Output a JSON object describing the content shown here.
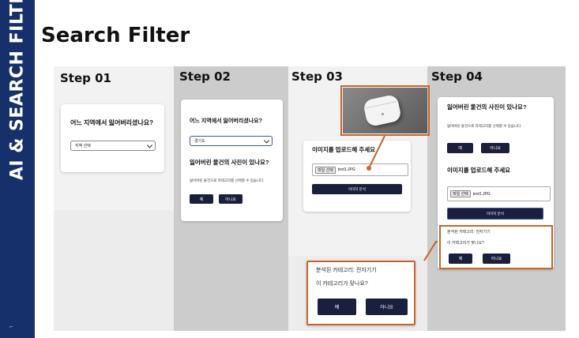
{
  "sidebar": {
    "title": "AI & SEARCH FILTER"
  },
  "slide": {
    "title": "Search Filter"
  },
  "steps": [
    {
      "label": "Step 01",
      "question": "어느 지역에서 잃어버리셨나요?",
      "select_value": "지역 선택"
    },
    {
      "label": "Step 02",
      "question": "어느 지역에서 잃어버리셨나요?",
      "select_value": "경기도",
      "photo_question": "잃어버린 물건의 사진이 있나요?",
      "photo_hint": "잃어버린 물건으로 카테고리를 선택할 수 있습니다.",
      "yes": "예",
      "no": "아니요"
    },
    {
      "label": "Step 03",
      "upload_title": "이미지를 업로드해 주세요",
      "choose_file": "파일 선택",
      "file_name": "test1.JPG",
      "analyze": "이미지 분석"
    },
    {
      "label": "Step 04",
      "photo_question": "잃어버린 물건의 사진이 있나요?",
      "photo_hint": "잃어버린 물건으로 카테고리를 선택할 수 있습니다.",
      "yes": "예",
      "no": "아니요",
      "upload_title": "이미지를 업로드해 주세요",
      "choose_file": "파일 선택",
      "file_name": "test1.JPG",
      "analyze": "이미지 분석",
      "result_category": "분석된 카테고리: 전자기기",
      "result_confirm": "이 카테고리가 맞나요?"
    }
  ],
  "zoom": {
    "result_category": "분석된 카테고리: 전자기기",
    "result_confirm": "이 카테고리가 맞나요?",
    "yes": "예",
    "no": "아니요"
  },
  "colors": {
    "sidebar": "#15306b",
    "button": "#1a1f3d",
    "highlight": "#c8642a"
  }
}
